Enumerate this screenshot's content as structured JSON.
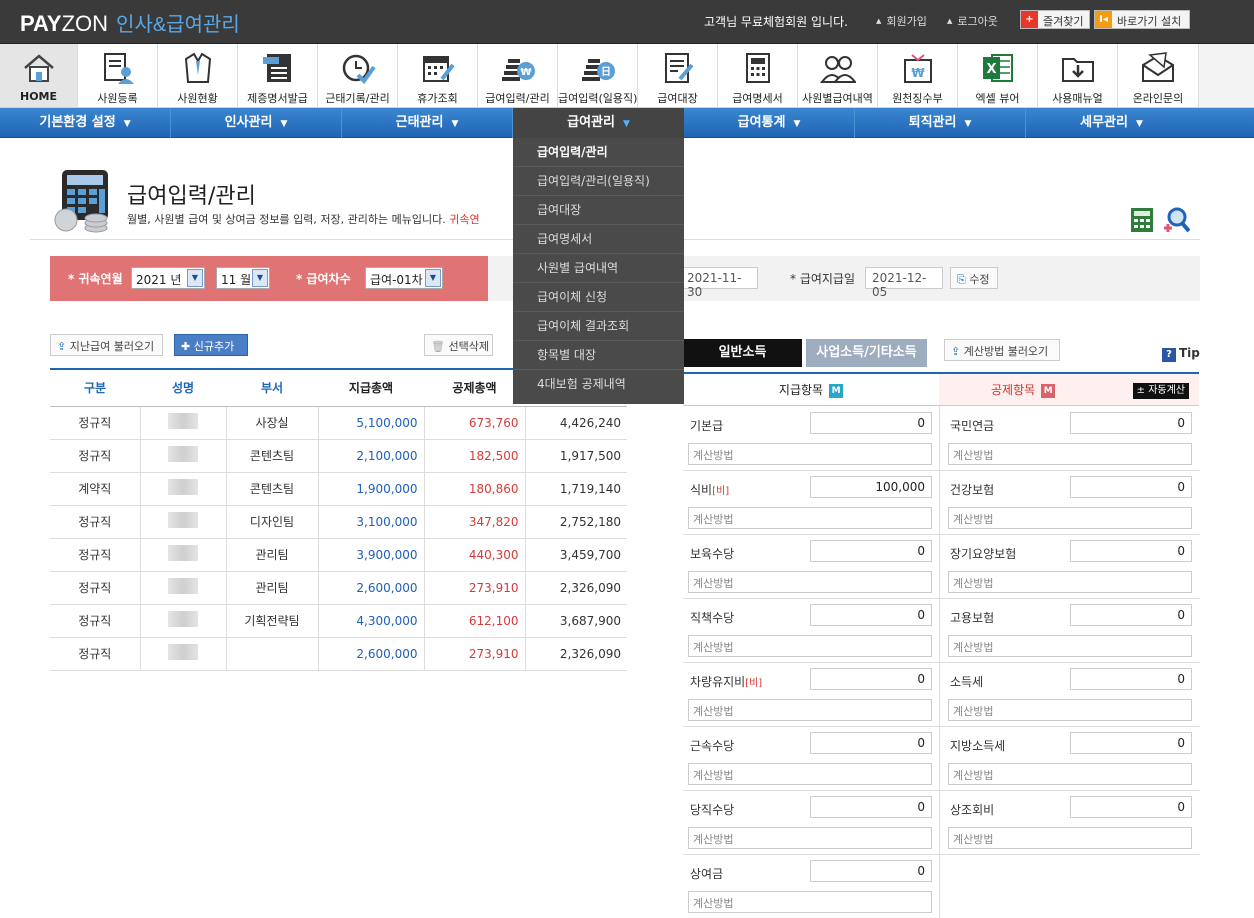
{
  "header": {
    "logo_a": "PAY",
    "logo_b": "ZON",
    "logo_sub": "인사&급여관리",
    "greeting": "고객님 무료체험회원 입니다.",
    "join": "회원가입",
    "logout": "로그아웃",
    "favorite": "즐겨찾기",
    "shortcut": "바로가기 설치"
  },
  "iconbar": [
    "HOME",
    "사원등록",
    "사원현황",
    "제증명서발급",
    "근태기록/관리",
    "휴가조회",
    "급여입력/관리",
    "급여입력(일용직)",
    "급여대장",
    "급여명세서",
    "사원별급여내역",
    "원천징수부",
    "엑셀 뷰어",
    "사용매뉴얼",
    "온라인문의"
  ],
  "menu": [
    "기본환경 설정",
    "인사관리",
    "근태관리",
    "급여관리",
    "급여통계",
    "퇴직관리",
    "세무관리"
  ],
  "dropdown": [
    "급여입력/관리",
    "급여입력/관리(일용직)",
    "급여대장",
    "급여명세서",
    "사원별 급여내역",
    "급여이체 신청",
    "급여이체 결과조회",
    "항목별 대장",
    "4대보험 공제내역"
  ],
  "page": {
    "title": "급여입력/관리",
    "desc": "월별, 사원별 급여 및 상여금 정보를 입력, 저장, 관리하는 메뉴입니다.",
    "desc_red": "귀속연"
  },
  "filter": {
    "period_label": "* 귀속연월",
    "year": "2021 년",
    "month": "11 월",
    "round_label": "* 급여차수",
    "round": "급여-01차",
    "date1": "2021-11-30",
    "pay_date_label": "* 급여지급일",
    "pay_date": "2021-12-05",
    "edit": "수정"
  },
  "buttons": {
    "load_prev": "지난급여 불러오기",
    "add_new": "신규추가",
    "delete_sel": "선택삭제",
    "load_calc": "계산방법 불러오기",
    "tip": "Tip"
  },
  "table": {
    "headers": [
      "구분",
      "성명",
      "부서",
      "지급총액",
      "공제총액",
      ""
    ],
    "rows": [
      [
        "정규직",
        "",
        "사장실",
        "5,100,000",
        "673,760",
        "4,426,240"
      ],
      [
        "정규직",
        "",
        "콘텐츠팀",
        "2,100,000",
        "182,500",
        "1,917,500"
      ],
      [
        "계약직",
        "",
        "콘텐츠팀",
        "1,900,000",
        "180,860",
        "1,719,140"
      ],
      [
        "정규직",
        "",
        "디자인팀",
        "3,100,000",
        "347,820",
        "2,752,180"
      ],
      [
        "정규직",
        "",
        "관리팀",
        "3,900,000",
        "440,300",
        "3,459,700"
      ],
      [
        "정규직",
        "",
        "관리팀",
        "2,600,000",
        "273,910",
        "2,326,090"
      ],
      [
        "정규직",
        "",
        "기획전략팀",
        "4,300,000",
        "612,100",
        "3,687,900"
      ],
      [
        "정규직",
        "",
        "",
        "2,600,000",
        "273,910",
        "2,326,090"
      ]
    ]
  },
  "tabs": {
    "general": "일반소득",
    "business": "사업소득/기타소득"
  },
  "pay_header": "지급항목",
  "ded_header": "공제항목",
  "auto_calc": "± 자동계산",
  "m": "M",
  "calc_placeholder": "계산방법",
  "pay_items": [
    {
      "name": "기본급",
      "tag": "",
      "value": "0"
    },
    {
      "name": "식비",
      "tag": "[비]",
      "value": "100,000"
    },
    {
      "name": "보육수당",
      "tag": "",
      "value": "0"
    },
    {
      "name": "직책수당",
      "tag": "",
      "value": "0"
    },
    {
      "name": "차량유지비",
      "tag": "[비]",
      "value": "0"
    },
    {
      "name": "근속수당",
      "tag": "",
      "value": "0"
    },
    {
      "name": "당직수당",
      "tag": "",
      "value": "0"
    },
    {
      "name": "상여금",
      "tag": "",
      "value": "0"
    }
  ],
  "ded_items": [
    {
      "name": "국민연금",
      "value": "0"
    },
    {
      "name": "건강보험",
      "value": "0"
    },
    {
      "name": "장기요양보험",
      "value": "0"
    },
    {
      "name": "고용보험",
      "value": "0"
    },
    {
      "name": "소득세",
      "value": "0"
    },
    {
      "name": "지방소득세",
      "value": "0"
    },
    {
      "name": "상조회비",
      "value": "0"
    }
  ]
}
